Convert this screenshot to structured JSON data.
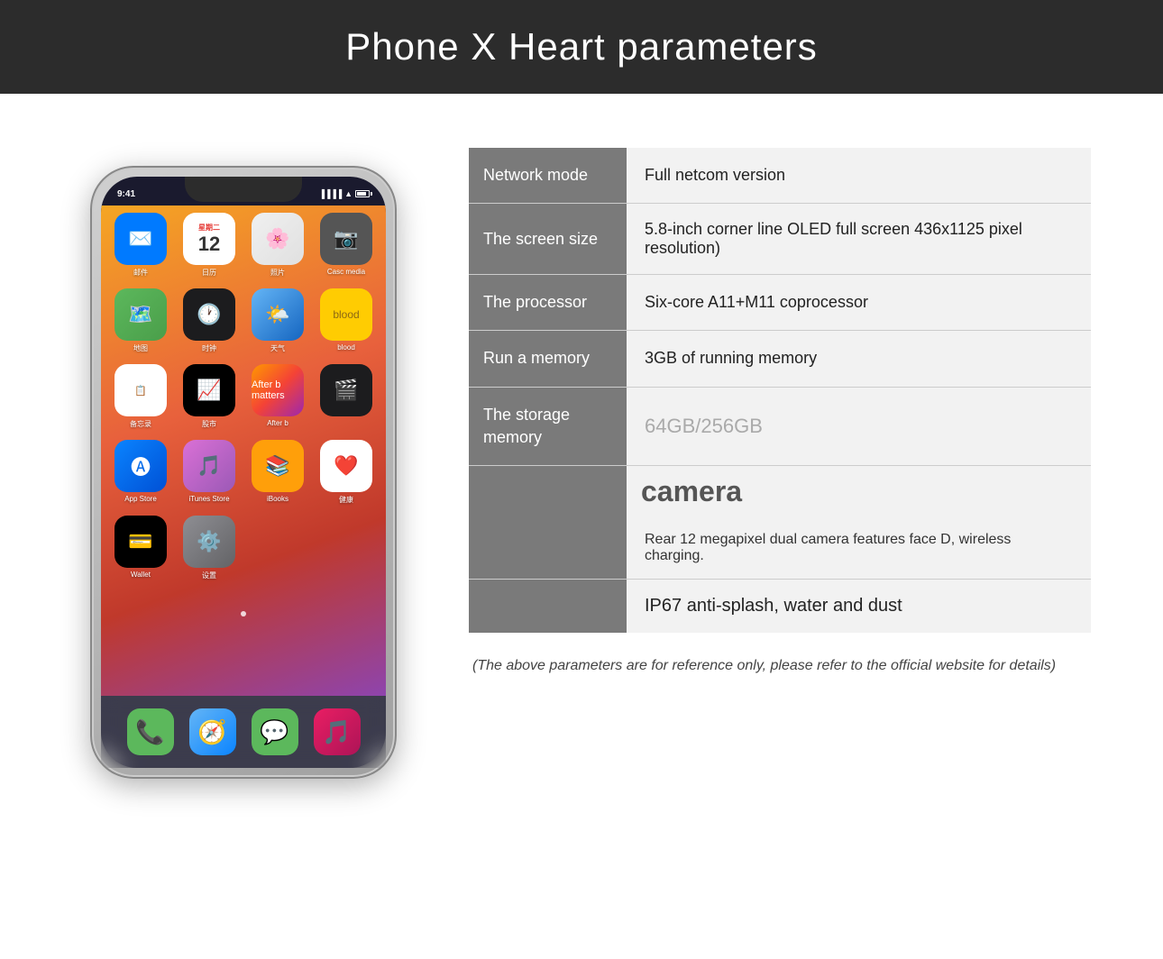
{
  "header": {
    "title": "Phone X Heart parameters"
  },
  "params": [
    {
      "label": "Network mode",
      "value": "Full netcom version",
      "grayed": false
    },
    {
      "label": "The screen size",
      "value": "5.8-inch corner line OLED full screen 436x1125 pixel resolution)",
      "grayed": false
    },
    {
      "label": "The processor",
      "value": "Six-core A11+M11 coprocessor",
      "grayed": false
    },
    {
      "label": "Run a memory",
      "value": "3GB of running memory",
      "grayed": false
    },
    {
      "label": "The storage memory",
      "value": "64GB/256GB",
      "grayed": true
    }
  ],
  "camera": {
    "label": "camera",
    "description": "Rear 12 megapixel dual camera features face D, wireless charging.",
    "ip67": "IP67 anti-splash, water and dust"
  },
  "disclaimer": "(The above parameters are for reference only, please refer to the official website for details)",
  "phone": {
    "time": "9:41",
    "dock": [
      "📞",
      "🧭",
      "💬",
      "🎵"
    ]
  }
}
